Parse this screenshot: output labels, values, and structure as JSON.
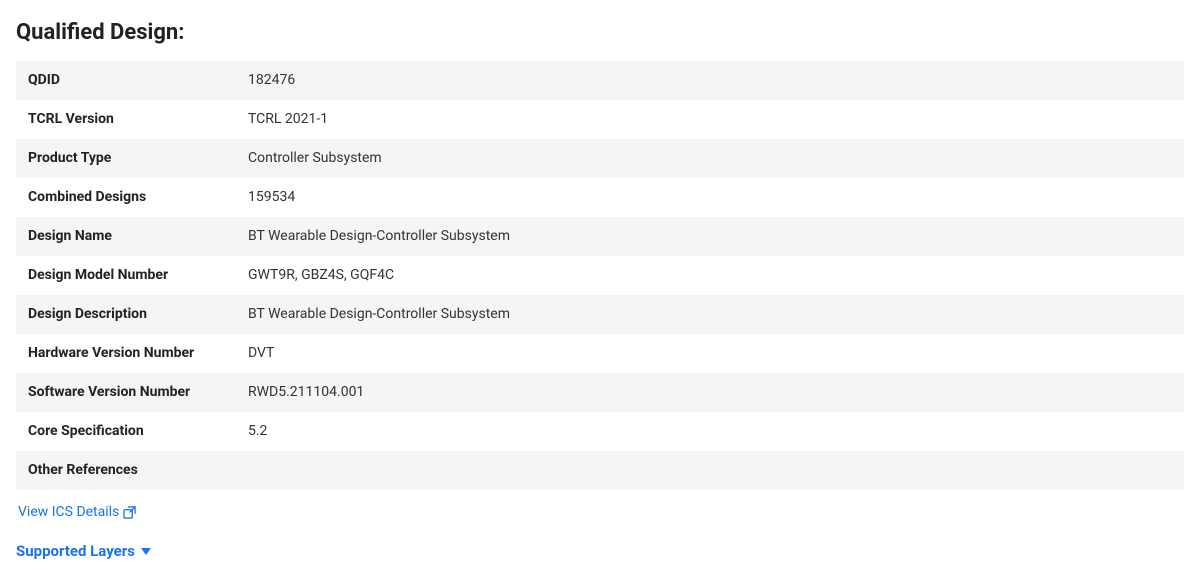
{
  "page": {
    "title": "Qualified Design:"
  },
  "table": {
    "rows": [
      {
        "label": "QDID",
        "value": "182476"
      },
      {
        "label": "TCRL Version",
        "value": "TCRL 2021-1"
      },
      {
        "label": "Product Type",
        "value": "Controller Subsystem"
      },
      {
        "label": "Combined Designs",
        "value": "159534"
      },
      {
        "label": "Design Name",
        "value": "BT Wearable Design-Controller Subsystem"
      },
      {
        "label": "Design Model Number",
        "value": "GWT9R, GBZ4S, GQF4C"
      },
      {
        "label": "Design Description",
        "value": "BT Wearable Design-Controller Subsystem"
      },
      {
        "label": "Hardware Version Number",
        "value": "DVT"
      },
      {
        "label": "Software Version Number",
        "value": "RWD5.211104.001"
      },
      {
        "label": "Core Specification",
        "value": "5.2"
      },
      {
        "label": "Other References",
        "value": ""
      }
    ]
  },
  "links": {
    "view_ics": "View ICS Details"
  },
  "supported_layers": {
    "label": "Supported Layers"
  }
}
